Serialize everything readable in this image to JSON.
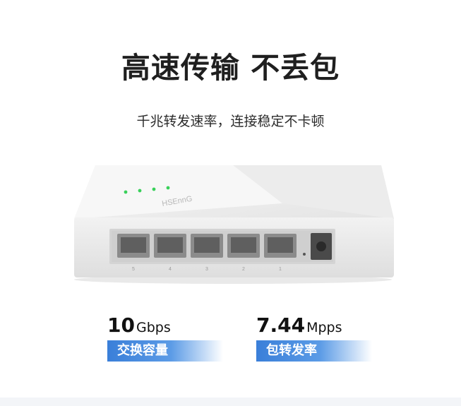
{
  "headline": "高速传输 不丢包",
  "subheadline": "千兆转发速率，连接稳定不卡顿",
  "product": {
    "brand_logo": "HSEnnG",
    "port_numbers": [
      "5",
      "4",
      "3",
      "2",
      "1"
    ]
  },
  "stats": [
    {
      "value": "10",
      "unit": "Gbps",
      "label": "交换容量"
    },
    {
      "value": "7.44",
      "unit": "Mpps",
      "label": "包转发率"
    }
  ],
  "colors": {
    "badge_blue": "#3a7fd9",
    "led_green": "#39d05a"
  }
}
